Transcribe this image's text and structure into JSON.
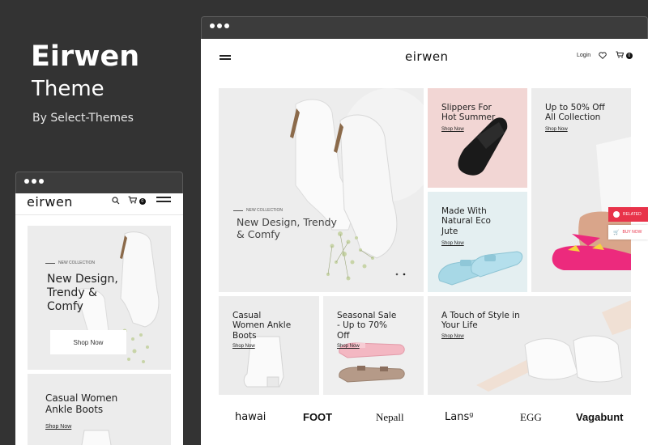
{
  "branding": {
    "title": "Eirwen",
    "subtitle": "Theme",
    "byline": "By Select-Themes"
  },
  "desktop": {
    "header": {
      "logo": "eirwen",
      "login_label": "Login",
      "cart_count": "0"
    },
    "hero": {
      "label": "NEW COLLECTION",
      "title_line1": "New Design, Trendy",
      "title_line2": "& Comfy"
    },
    "tiles": [
      {
        "title_line1": "Slippers For",
        "title_line2": "Hot Summer",
        "title_line3": "",
        "link": "Shop Now"
      },
      {
        "title_line1": "Up to 50% Off",
        "title_line2": "All Collection",
        "title_line3": "",
        "link": "Shop Now"
      },
      {
        "title_line1": "Made With",
        "title_line2": "Natural Eco",
        "title_line3": "Jute",
        "link": "Shop Now"
      },
      {
        "title_line1": "Casual",
        "title_line2": "Women Ankle",
        "title_line3": "Boots",
        "link": "Shop Now"
      },
      {
        "title_line1": "Seasonal Sale",
        "title_line2": "- Up to 70%",
        "title_line3": "Off",
        "link": "Shop Now"
      },
      {
        "title_line1": "A Touch of Style in",
        "title_line2": "Your Life",
        "title_line3": "",
        "link": "Shop Now"
      }
    ],
    "side_tabs": {
      "related": "RELATED",
      "buy": "BUY NOW"
    },
    "brands": [
      "hawai",
      "FOOT",
      "Nepall",
      "Lansᵍ",
      "EGG",
      "Vagabunt"
    ]
  },
  "mobile": {
    "header": {
      "logo": "eirwen",
      "cart_count": "0"
    },
    "hero": {
      "label": "NEW COLLECTION",
      "title_line1": "New Design,",
      "title_line2": "Trendy &",
      "title_line3": "Comfy",
      "button": "Shop Now"
    },
    "tile": {
      "title_line1": "Casual Women",
      "title_line2": "Ankle Boots",
      "link": "Shop Now"
    }
  },
  "colors": {
    "background": "#333333",
    "accent": "#e8334a",
    "pink_sandal": "#ec2a7d",
    "blue_sandal": "#9fd4e2"
  }
}
